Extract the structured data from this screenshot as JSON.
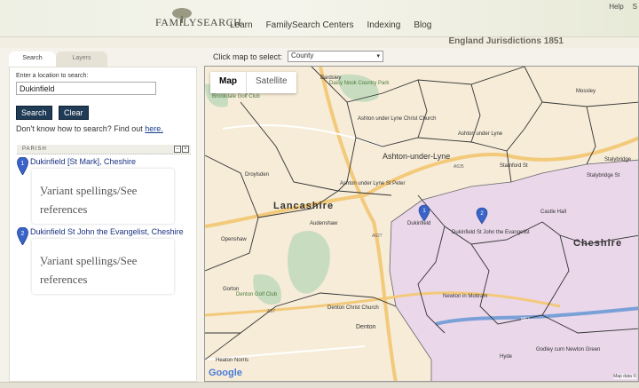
{
  "header": {
    "logo_text": "FAMILYSEARCH",
    "nav": [
      "Learn",
      "FamilySearch Centers",
      "Indexing",
      "Blog"
    ],
    "top_links": [
      "Help",
      "S"
    ],
    "jurisdiction_title": "England Jurisdictions 1851"
  },
  "sidebar": {
    "tabs": [
      "Search",
      "Layers"
    ],
    "search_label": "Enter a location to search:",
    "search_value": "Dukinfield",
    "search_button": "Search",
    "clear_button": "Clear",
    "help_text": "Don't know how to search? Find out ",
    "help_link": "here.",
    "section_title": "PARISH",
    "minimize": "–",
    "close": "×",
    "results": [
      {
        "number": "1",
        "title": "Dukinfield [St Mark], Cheshire",
        "variant": "Variant spellings/See references",
        "arrow": "▸"
      },
      {
        "number": "2",
        "title": "Dukinfield St John the Evangelist, Cheshire",
        "variant": "Variant spellings/See references",
        "arrow": "▸"
      }
    ]
  },
  "map_controls": {
    "select_label": "Click map to select:",
    "select_value": "County",
    "map_button": "Map",
    "satellite_button": "Satellite",
    "google_logo": "Google",
    "map_data": "Map data ©"
  },
  "map_labels": {
    "counties": [
      "Lancashire",
      "Cheshire"
    ],
    "places": [
      "Bardsley",
      "Daisy Nook Country Park",
      "Mossley",
      "Brookdale Golf Club",
      "Ashton under Lyne Christ Church",
      "Ashton-under-Lyne",
      "Ashton under Lyne",
      "Droylsden",
      "Ashton under Lyne St Peter",
      "Stalybridge",
      "Audenshaw",
      "Castle Hall",
      "Dukinfield",
      "Dukinfield St John the Evangelist",
      "Openshaw",
      "Gorton",
      "Denton Golf Club",
      "Newton in Mottram",
      "Denton Christ Church",
      "Denton",
      "Hyde",
      "Godley cum Newton Green",
      "Heaton Norris",
      "Stamford St",
      "Stalybridge St"
    ],
    "roads": [
      "A635",
      "A57",
      "M67",
      "A627"
    ]
  },
  "colors": {
    "cheshire_fill": "#ead7ea",
    "lancashire_fill": "#f6ecd8",
    "pin": "#3a64c9",
    "button": "#1f3b55"
  }
}
